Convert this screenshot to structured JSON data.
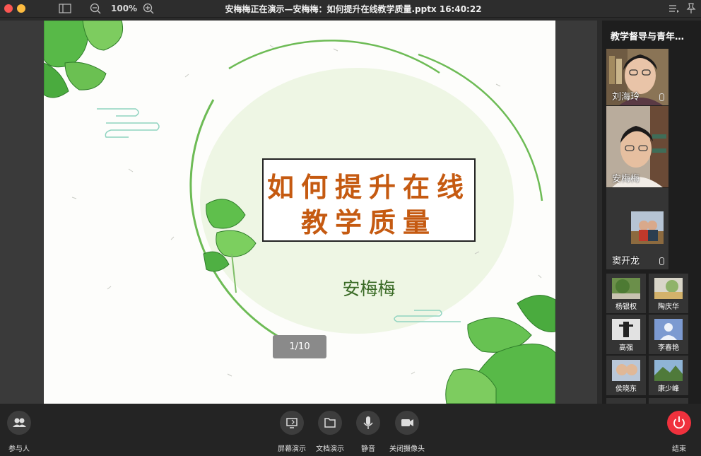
{
  "window": {
    "title": "安梅梅正在演示—安梅梅：如何提升在线教学质量.pptx 16:40:22",
    "zoom": "100%"
  },
  "slide": {
    "title_line1": "如何提升在线",
    "title_line2": "教学质量",
    "author": "安梅梅",
    "pager": "1/10"
  },
  "panel": {
    "room_name": "教学督导与青年…",
    "video_tiles": [
      {
        "name": "刘海玲"
      },
      {
        "name": "安梅梅"
      },
      {
        "name": "窦开龙"
      }
    ],
    "participants": [
      {
        "name": "杨银权"
      },
      {
        "name": "陶庆华"
      },
      {
        "name": "高强"
      },
      {
        "name": "李春艳"
      },
      {
        "name": "侯晓东"
      },
      {
        "name": "康少峰"
      }
    ]
  },
  "toolbar": {
    "participants_label": "参与人",
    "screen_share_label": "屏幕演示",
    "doc_share_label": "文档演示",
    "mute_label": "静音",
    "camera_label": "关闭摄像头",
    "end_label": "结束"
  },
  "colors": {
    "end_button": "#f0313d",
    "title_text": "#c55a11",
    "leaf_green": "#5fb84a"
  }
}
